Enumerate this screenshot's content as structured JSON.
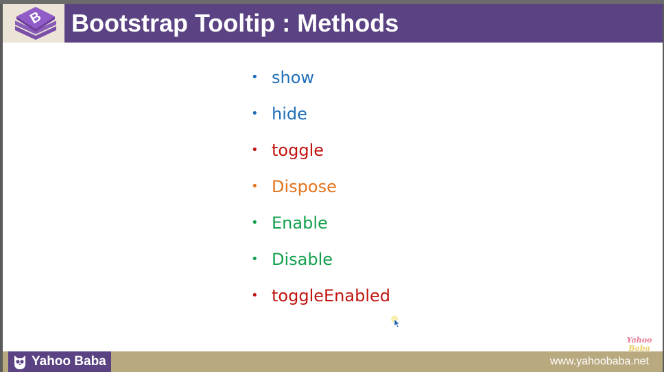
{
  "slide": {
    "title": "Bootstrap Tooltip : Methods",
    "logo_icon": "bootstrap-logo-icon",
    "methods": [
      {
        "label": "show",
        "color": "#1f6fb8"
      },
      {
        "label": "hide",
        "color": "#1f6fb8"
      },
      {
        "label": "toggle",
        "color": "#c0150f"
      },
      {
        "label": "Dispose",
        "color": "#e3731c"
      },
      {
        "label": "Enable",
        "color": "#13a04d"
      },
      {
        "label": "Disable",
        "color": "#13a04d"
      },
      {
        "label": "toggleEnabled",
        "color": "#c0150f"
      }
    ],
    "bullet": "•"
  },
  "footer": {
    "brand_name": "Yahoo Baba",
    "url": "www.yahoobaba.net",
    "watermark_line1": "Yahoo",
    "watermark_line2": "Baba"
  },
  "colors": {
    "header": "#5a4283",
    "footer": "#b9a97e",
    "logo_panel": "#ebe4d7"
  }
}
